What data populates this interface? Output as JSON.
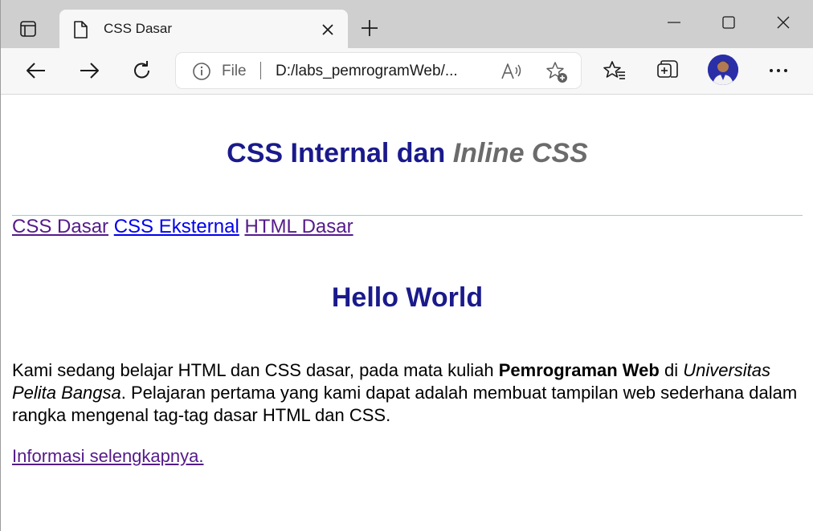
{
  "browser": {
    "tab_title": "CSS Dasar",
    "address_scheme": "File",
    "address_url": "D:/labs_pemrogramWeb/..."
  },
  "page": {
    "heading_main": "CSS Internal dan",
    "heading_inline": "Inline CSS",
    "nav_links": [
      "CSS Dasar",
      "CSS Eksternal",
      "HTML Dasar"
    ],
    "hello_heading": "Hello World",
    "paragraph": {
      "part1": "Kami sedang belajar HTML dan CSS dasar, pada mata kuliah ",
      "bold": "Pemrograman Web",
      "part2": " di ",
      "italic": "Universitas Pelita Bangsa",
      "part3": ". Pelajaran pertama yang kami dapat adalah membuat tampilan web sederhana dalam rangka mengenal tag-tag dasar HTML dan CSS."
    },
    "more_link": "Informasi selengkapnya."
  },
  "icons": {
    "tab_actions": "tab-actions-icon",
    "page": "page-icon",
    "close_tab": "close-icon",
    "new_tab": "plus-icon",
    "back": "arrow-left-icon",
    "forward": "arrow-right-icon",
    "refresh": "refresh-icon",
    "site_info": "info-icon",
    "read_aloud": "read-aloud-icon",
    "add_favorite": "star-add-icon",
    "favorites": "favorites-icon",
    "collections": "collections-icon",
    "profile": "avatar",
    "menu": "more-icon"
  },
  "colors": {
    "heading": "#1a1a8c",
    "heading_italic": "#6b6b6b",
    "link": "#0000ee",
    "visited_link": "#551a8b",
    "rule": "#8fd0dc"
  }
}
